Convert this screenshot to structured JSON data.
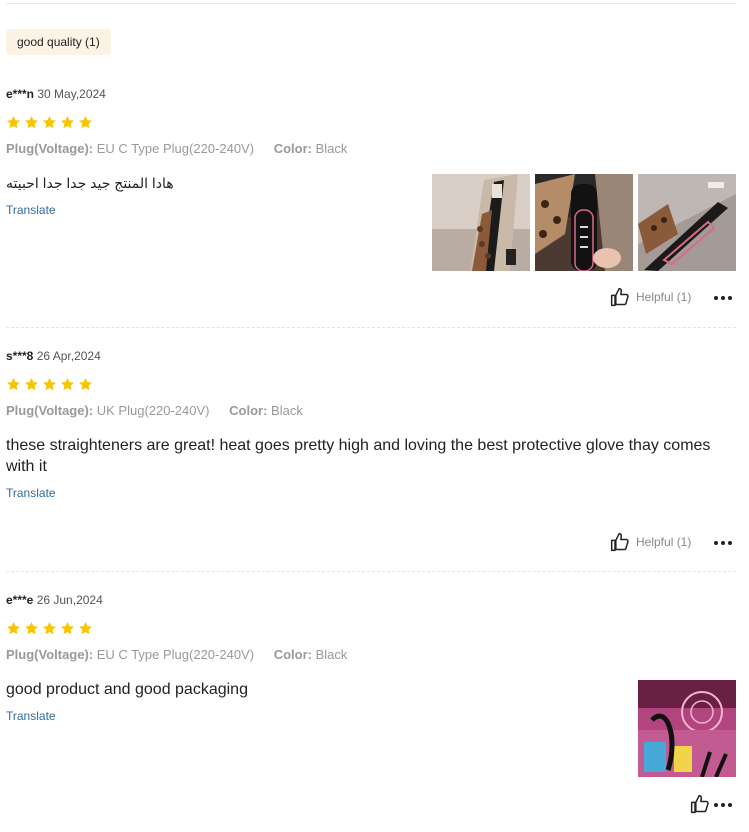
{
  "filter_tag": {
    "label": "good quality (1)"
  },
  "reviews": [
    {
      "user": "e***n",
      "date": "30 May,2024",
      "rating": 5,
      "plug_label": "Plug(Voltage):",
      "plug_value": "EU C Type Plug(220-240V)",
      "color_label": "Color:",
      "color_value": "Black",
      "text": "هادا المنتج جيد جدا جدا احبيته",
      "translate_label": "Translate",
      "helpful_label": "Helpful (1)",
      "photo_count": 3
    },
    {
      "user": "s***8",
      "date": "26 Apr,2024",
      "rating": 5,
      "plug_label": "Plug(Voltage):",
      "plug_value": "UK Plug(220-240V)",
      "color_label": "Color:",
      "color_value": "Black",
      "text": "these straighteners are great! heat goes pretty high and loving the best protective glove thay comes with it",
      "translate_label": "Translate",
      "helpful_label": "Helpful (1)",
      "photo_count": 0
    },
    {
      "user": "e***e",
      "date": "26 Jun,2024",
      "rating": 5,
      "plug_label": "Plug(Voltage):",
      "plug_value": "EU C Type Plug(220-240V)",
      "color_label": "Color:",
      "color_value": "Black",
      "text": "good product and good packaging",
      "translate_label": "Translate",
      "photo_count": 1
    }
  ],
  "colors": {
    "star": "#f7c600",
    "link": "#2e6da4",
    "tag_bg": "#fdf3e4"
  },
  "icons": {
    "rating": "star-icon",
    "helpful": "thumbs-up-icon",
    "more": "more-dots-icon"
  }
}
